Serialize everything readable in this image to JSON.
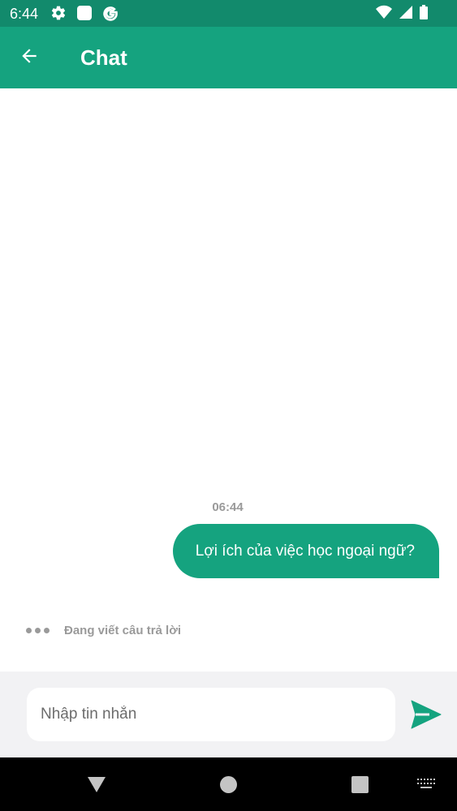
{
  "status_bar": {
    "time": "6:44",
    "icons": [
      "settings-icon",
      "app-square-icon",
      "google-icon",
      "wifi-icon",
      "signal-icon",
      "battery-icon"
    ]
  },
  "app_bar": {
    "title": "Chat",
    "back_icon": "arrow-left-icon"
  },
  "chat": {
    "messages": [
      {
        "time": "06:44",
        "text": "Lợi ích của việc học ngoại ngữ?",
        "sender": "user"
      }
    ],
    "typing_indicator": "Đang viết câu trả lời"
  },
  "input": {
    "placeholder": "Nhập tin nhắn",
    "value": "",
    "send_icon": "send-icon"
  },
  "nav_bar": {
    "icons": [
      "nav-back-icon",
      "nav-home-icon",
      "nav-recents-icon",
      "keyboard-icon"
    ]
  },
  "colors": {
    "status_bar": "#128a6c",
    "primary": "#15a37f",
    "muted_text": "#9a9a9a",
    "input_bar_bg": "#f2f2f4"
  }
}
